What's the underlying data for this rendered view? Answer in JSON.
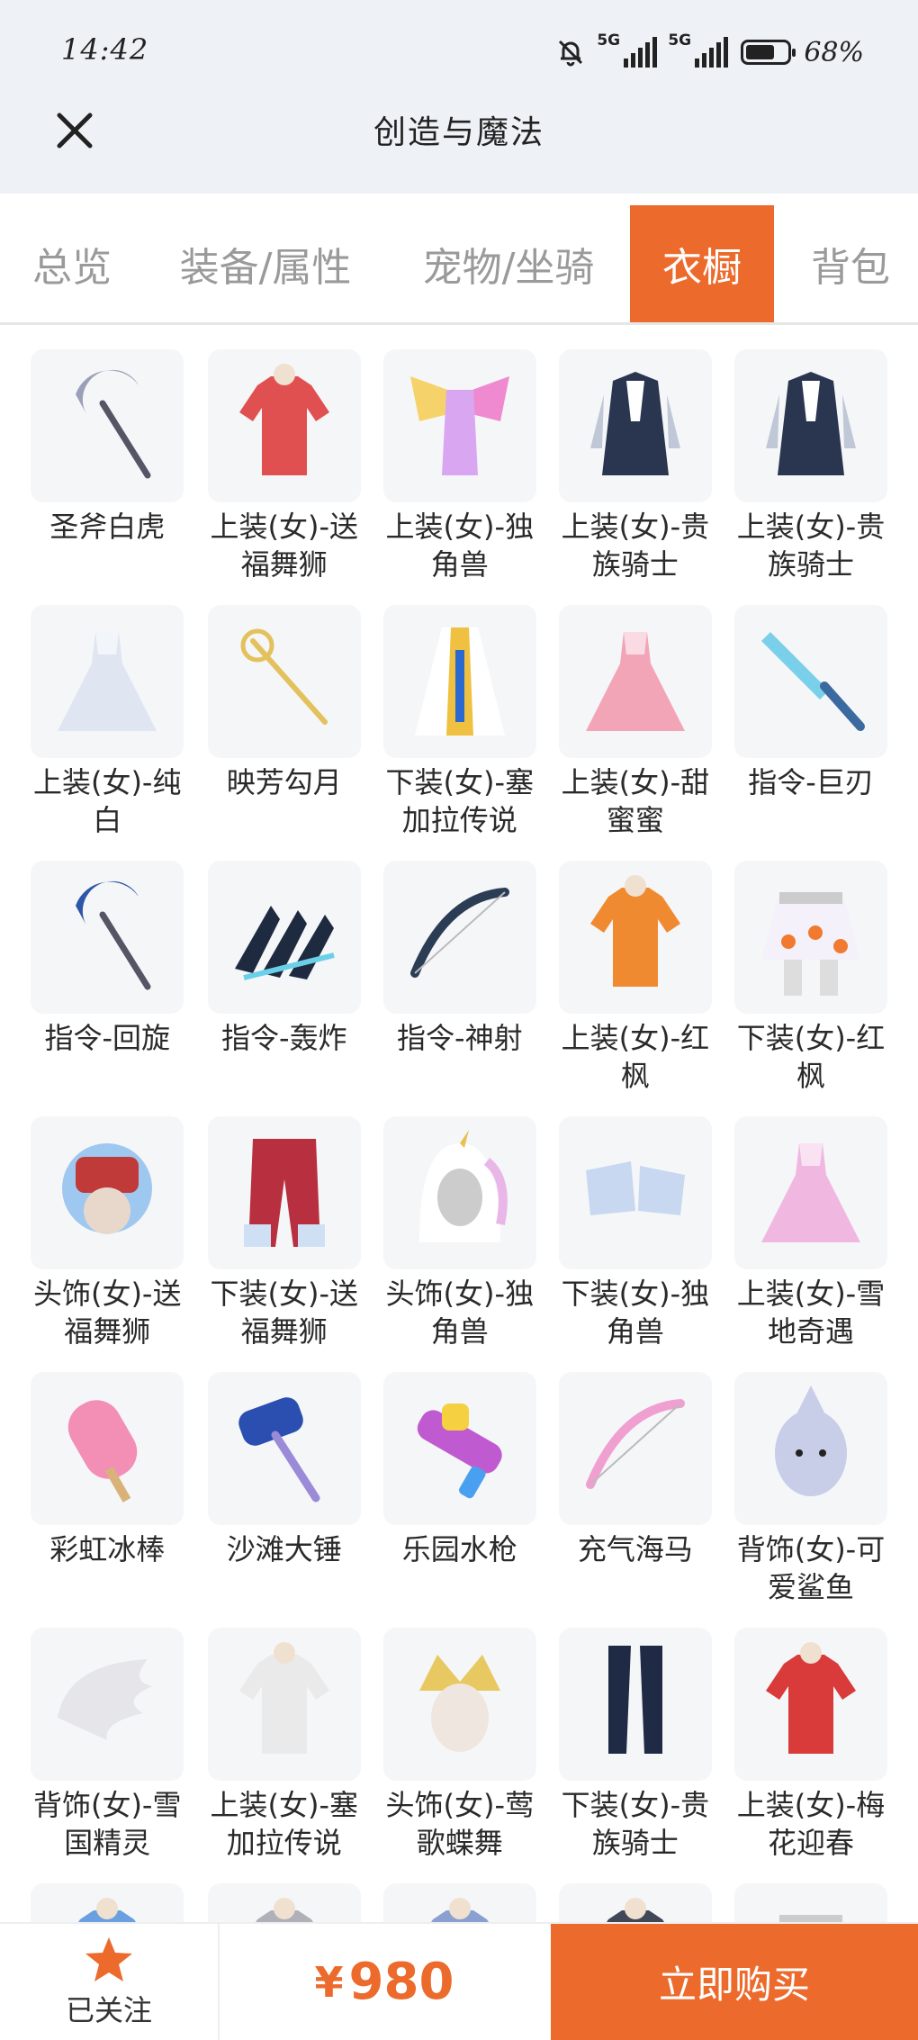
{
  "status": {
    "time": "14:42",
    "net1": "5G",
    "net2": "5G",
    "battery": "68%"
  },
  "header": {
    "title": "创造与魔法"
  },
  "tabs": [
    {
      "label": "总览"
    },
    {
      "label": "装备/属性"
    },
    {
      "label": "宠物/坐骑"
    },
    {
      "label": "衣橱"
    },
    {
      "label": "背包"
    }
  ],
  "items": [
    {
      "name": "圣斧白虎",
      "icon": "scythe-icon",
      "color": "#9aa0b8"
    },
    {
      "name": "上装(女)-送福舞狮",
      "icon": "outfit-top-icon",
      "color": "#e05050"
    },
    {
      "name": "上装(女)-独角兽",
      "icon": "winged-outfit-icon",
      "color": "#d9a6f2"
    },
    {
      "name": "上装(女)-贵族骑士",
      "icon": "coat-icon",
      "color": "#2a3550"
    },
    {
      "name": "上装(女)-贵族骑士",
      "icon": "coat-icon",
      "color": "#2a3550"
    },
    {
      "name": "上装(女)-纯白",
      "icon": "dress-icon",
      "color": "#dfe6f2"
    },
    {
      "name": "映芳勾月",
      "icon": "staff-icon",
      "color": "#e3c15c"
    },
    {
      "name": "下装(女)-塞加拉传说",
      "icon": "robe-icon",
      "color": "#f0c040"
    },
    {
      "name": "上装(女)-甜蜜蜜",
      "icon": "dress-icon",
      "color": "#f3a5b8"
    },
    {
      "name": "指令-巨刃",
      "icon": "blade-icon",
      "color": "#3a6aa0"
    },
    {
      "name": "指令-回旋",
      "icon": "scythe-icon",
      "color": "#2d56a8"
    },
    {
      "name": "指令-轰炸",
      "icon": "claw-icon",
      "color": "#1e2a40"
    },
    {
      "name": "指令-神射",
      "icon": "bow-icon",
      "color": "#2b3d55"
    },
    {
      "name": "上装(女)-红枫",
      "icon": "outfit-top-icon",
      "color": "#f08a30"
    },
    {
      "name": "下装(女)-红枫",
      "icon": "skirt-icon",
      "color": "#f07a30"
    },
    {
      "name": "头饰(女)-送福舞狮",
      "icon": "lion-head-icon",
      "color": "#c03a3a"
    },
    {
      "name": "下装(女)-送福舞狮",
      "icon": "pants-icon",
      "color": "#b83040"
    },
    {
      "name": "头饰(女)-独角兽",
      "icon": "hood-icon",
      "color": "#e9b6e8"
    },
    {
      "name": "下装(女)-独角兽",
      "icon": "boots-icon",
      "color": "#c8d8f0"
    },
    {
      "name": "上装(女)-雪地奇遇",
      "icon": "dress-icon",
      "color": "#f0b8e0"
    },
    {
      "name": "彩虹冰棒",
      "icon": "popsicle-icon",
      "color": "#f38fb5"
    },
    {
      "name": "沙滩大锤",
      "icon": "hammer-icon",
      "color": "#2a4fb0"
    },
    {
      "name": "乐园水枪",
      "icon": "watergun-icon",
      "color": "#c05ad0"
    },
    {
      "name": "充气海马",
      "icon": "bow-icon",
      "color": "#f0a0d0"
    },
    {
      "name": "背饰(女)-可爱鲨鱼",
      "icon": "shark-icon",
      "color": "#c8cde8"
    },
    {
      "name": "背饰(女)-雪国精灵",
      "icon": "wing-icon",
      "color": "#e6e6ea"
    },
    {
      "name": "上装(女)-塞加拉传说",
      "icon": "outfit-top-icon",
      "color": "#eaeaea"
    },
    {
      "name": "头饰(女)-莺歌蝶舞",
      "icon": "crown-head-icon",
      "color": "#e8c860"
    },
    {
      "name": "下装(女)-贵族骑士",
      "icon": "legs-icon",
      "color": "#1f2a44"
    },
    {
      "name": "上装(女)-梅花迎春",
      "icon": "outfit-top-icon",
      "color": "#d93a3a"
    },
    {
      "name": "",
      "icon": "outfit-top-icon",
      "color": "#6aa0e0"
    },
    {
      "name": "",
      "icon": "outfit-top-icon",
      "color": "#b0b0b8"
    },
    {
      "name": "",
      "icon": "outfit-top-icon",
      "color": "#8aa0d0"
    },
    {
      "name": "",
      "icon": "outfit-top-icon",
      "color": "#404858"
    },
    {
      "name": "",
      "icon": "skirt-icon",
      "color": "#303038"
    }
  ],
  "bottom": {
    "follow_label": "已关注",
    "currency": "¥",
    "price": "980",
    "buy_label": "立即购买"
  },
  "colors": {
    "accent": "#ec6a2c"
  }
}
